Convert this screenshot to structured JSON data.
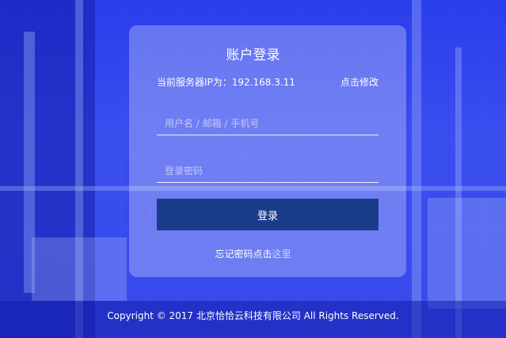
{
  "login": {
    "title": "账户登录",
    "ip_label": "当前服务器IP为：192.168.3.11",
    "modify_link": "点击修改",
    "username_placeholder": "用户名 / 邮箱 / 手机号",
    "password_placeholder": "登录密码",
    "submit_label": "登录",
    "forgot_text": "忘记密码点击",
    "forgot_link": "这里"
  },
  "footer": {
    "copyright": "Copyright © 2017 北京恰恰云科技有限公司 All Rights Reserved."
  },
  "colors": {
    "background_blue": "#3d4ef0",
    "button": "#1a3d8a",
    "text": "#ffffff"
  }
}
